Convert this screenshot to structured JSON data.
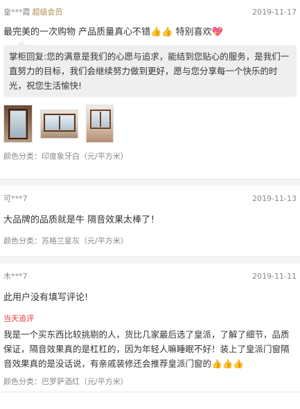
{
  "reviews": [
    {
      "user": "皇***霞",
      "badge": "超级会员",
      "date": "2019-11-17",
      "content": "最完美的一次购物 产品质量真心不错👍👍 特别喜欢💖",
      "reply": "掌柜回复:您的满意是我们的心愿与追求，能结到您贴心的服务，是我们一直努力的目标，我们会继续努力做到更好，愿与您分享每一个快乐的时光，祝您生活愉快!",
      "photos": [
        "window-photo-1",
        "window-photo-2",
        "window-photo-3"
      ],
      "spec": "颜色分类：印度象牙白（元/平方米）"
    },
    {
      "user": "可***7",
      "date": "2019-11-13",
      "content": "大品牌的品质就是牛 隔音效果太棒了！",
      "spec": "颜色分类：苏格兰星灰（元/平方米）"
    },
    {
      "user": "木***7",
      "date": "2019-11-11",
      "content": "此用户没有填写评论!",
      "append_label": "当天追评",
      "append_content": "我是一个买东西比较挑剔的人，货比几家最后选了皇派，了解了细节，品质保证，隔音效果真的是杠杠的，因为年轻人嘛睡眠不好！装上了皇派门窗隔音效果真的是没话说，有亲戚装修还会推荐皇派门窗的👍👍👍",
      "spec": "颜色分类：巴罗萨酒红（元/平方米）"
    }
  ]
}
